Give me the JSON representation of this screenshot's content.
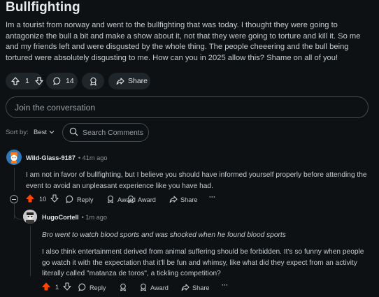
{
  "post": {
    "title": "Bullfighting",
    "body": "Im a tourist from norway and went to the bullfighting that was today. I thought they were going to antagonize the bull a bit and make a show about it, not that they were going to torture and kill it. So me and my friends left and were disgusted by the whole thing. The people cheeering and the bull being tortured were absolutely disgusting to me. How can you in 2025 allow this? Shame on all of you!",
    "votes": "1",
    "comments_count": "14",
    "share_label": "Share"
  },
  "composer": {
    "placeholder": "Join the conversation"
  },
  "sort": {
    "label": "Sort by:",
    "value": "Best"
  },
  "search": {
    "placeholder": "Search Comments"
  },
  "comments": [
    {
      "author": "Wild-Glass-9187",
      "time": "• 41m ago",
      "text": "I am not in favor of bullfighting, but I believe you should have informed yourself properly before attending the event to avoid an unpleasant experience like you have had.",
      "votes": "10",
      "reply_label": "Reply",
      "award_label": "Award",
      "share_label": "Share",
      "more_label": "···"
    },
    {
      "author": "HugoCortell",
      "time": "• 1m ago",
      "quote": "Bro went to watch blood sports and was shocked when he found blood sports",
      "text": "I also think entertainment derived from animal suffering should be forbidden. It's so funny when people go watch it with the expectation that it'll be fun and whimsy, like what did they expect from an activity literally called \"matanza de toros\", a tickling competition?",
      "votes": "1",
      "reply_label": "Reply",
      "award_label": "Award",
      "share_label": "Share",
      "more_label": "···"
    }
  ],
  "colors": {
    "background": "#0e1113",
    "upvote": "#ff4500",
    "pill": "#1f2528"
  }
}
